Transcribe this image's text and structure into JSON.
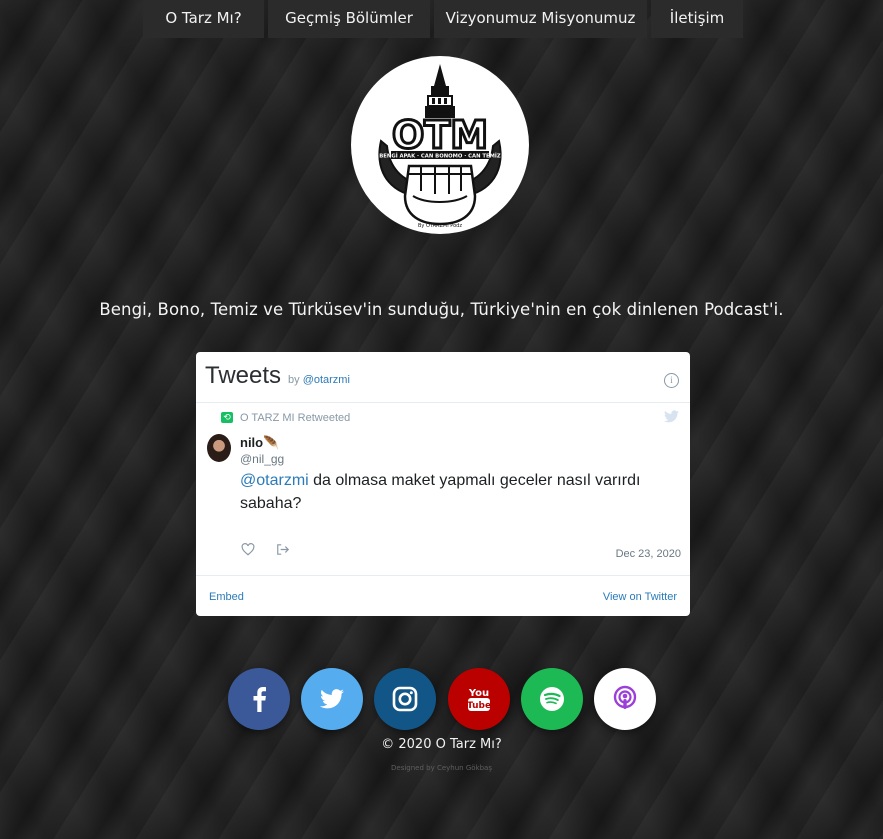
{
  "nav": {
    "items": [
      {
        "label": "O Tarz Mı?"
      },
      {
        "label": "Geçmiş Bölümler"
      },
      {
        "label": "Vizyonumuz Misyonumuz"
      },
      {
        "label": "İletişim"
      }
    ]
  },
  "logo": {
    "text": "OTM",
    "names": "BENGİ APAK · CAN BONOMO · CAN TEMİZ",
    "byline": "By OTARZMI Podz"
  },
  "tagline": "Bengi, Bono, Temiz ve Türküsev'in sunduğu, Türkiye'nin en çok dinlenen Podcast'i.",
  "twitter_widget": {
    "title": "Tweets",
    "by_prefix": "by",
    "by_handle": "@otarzmi",
    "retweet_text": "O TARZ MI Retweeted",
    "author_name": "nilo🪶",
    "author_handle": "@nil_gg",
    "tweet_mention": "@otarzmi",
    "tweet_rest": " da olmasa maket yapmalı geceler nasıl varırdı sabaha?",
    "date": "Dec 23, 2020",
    "embed_label": "Embed",
    "view_label": "View on Twitter"
  },
  "social": [
    {
      "icon": "facebook-icon",
      "color": "#3b5998"
    },
    {
      "icon": "twitter-icon",
      "color": "#55acee"
    },
    {
      "icon": "instagram-icon",
      "color": "#125688"
    },
    {
      "icon": "youtube-icon",
      "color": "#bb0000"
    },
    {
      "icon": "spotify-icon",
      "color": "#1db954"
    },
    {
      "icon": "podcasts-icon",
      "color": "#ffffff"
    }
  ],
  "footer": {
    "copyright": "© 2020 O Tarz Mı?",
    "designed_by": "Designed by Ceyhun Gökbaş"
  }
}
